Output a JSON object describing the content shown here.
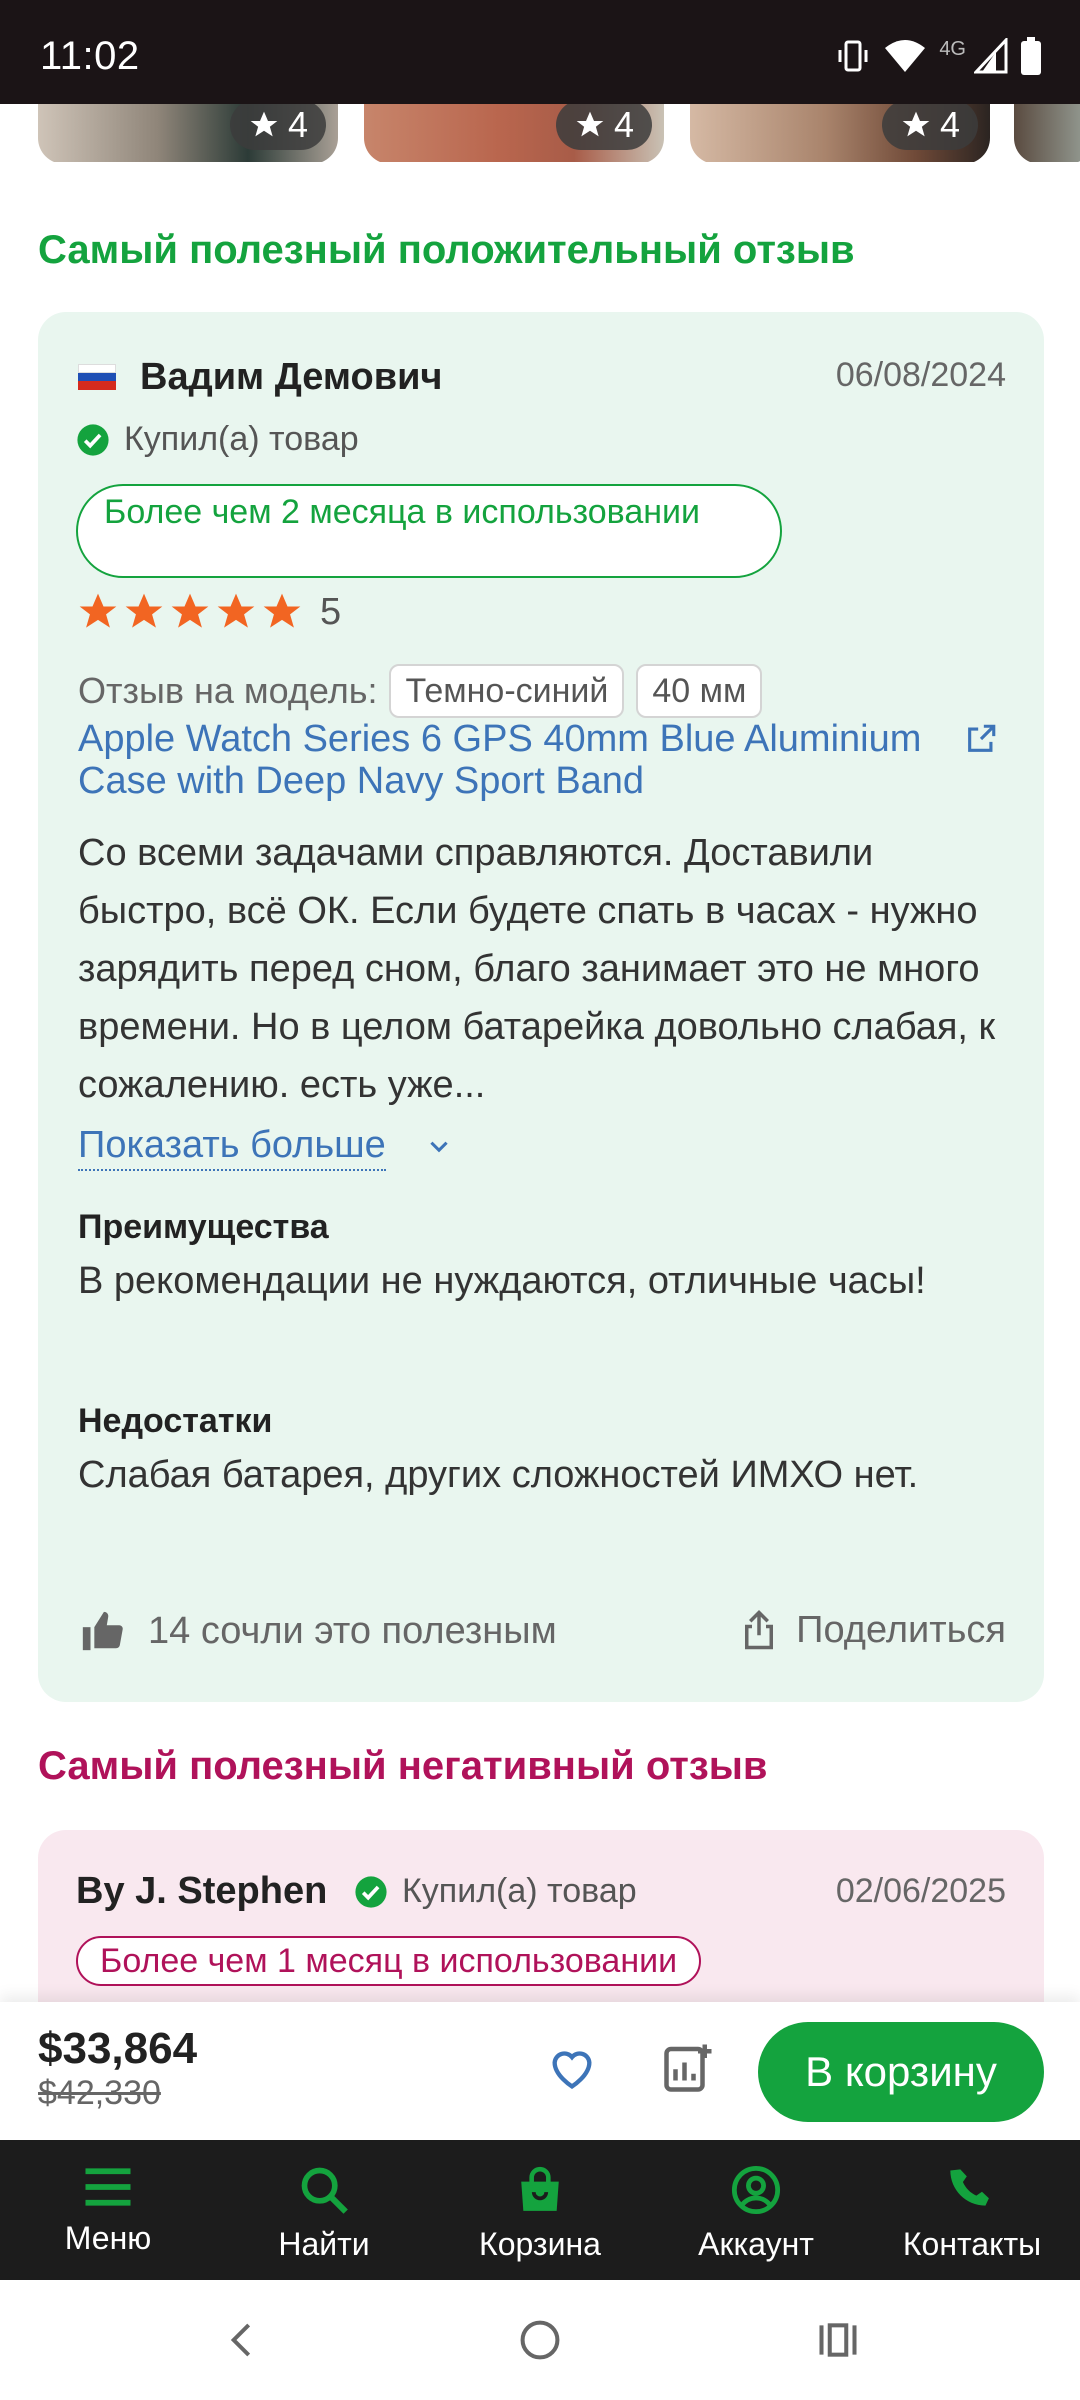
{
  "status_bar": {
    "time": "11:02",
    "network": "4G"
  },
  "photos": [
    {
      "rating": "4"
    },
    {
      "rating": "4"
    },
    {
      "rating": "4"
    }
  ],
  "positive": {
    "section_title": "Самый полезный положительный отзыв",
    "author": "Вадим Демович",
    "date": "06/08/2024",
    "verified": "Купил(а) товар",
    "usage": "Более чем 2 месяца в использовании",
    "rating": "5",
    "model_label": "Отзыв на модель:",
    "chips": [
      "Темно-синий",
      "40 мм"
    ],
    "product_link": "Apple Watch Series 6 GPS 40mm Blue Aluminium Case with Deep Navy Sport Band",
    "text": "Со всеми задачами справляются. Доставили быстро, всё ОК. Если будете спать в часах - нужно зарядить перед сном, благо занимает это не много времени. Но в целом батарейка довольно слабая, к сожалению. есть уже...",
    "show_more": "Показать больше",
    "pros_title": "Преимущества",
    "pros": "В рекомендации не нуждаются, отличные часы!",
    "cons_title": "Недостатки",
    "cons": "Слабая батарея, других сложностей ИМХО нет.",
    "helpful": "14 сочли это полезным",
    "share": "Поделиться"
  },
  "negative": {
    "section_title": "Самый полезный негативный отзыв",
    "author": "By J. Stephen",
    "verified": "Купил(а) товар",
    "date": "02/06/2025",
    "usage": "Более чем 1 месяц в использовании"
  },
  "buy_bar": {
    "price": "$33,864",
    "old_price": "$42,330",
    "cart_label": "В корзину"
  },
  "bottom_nav": {
    "items": [
      {
        "label": "Меню",
        "icon": "menu-icon"
      },
      {
        "label": "Найти",
        "icon": "search-icon"
      },
      {
        "label": "Корзина",
        "icon": "bag-icon"
      },
      {
        "label": "Аккаунт",
        "icon": "account-icon"
      },
      {
        "label": "Контакты",
        "icon": "phone-icon"
      }
    ]
  },
  "colors": {
    "green": "#14a33e",
    "magenta": "#b0125a",
    "link": "#3d74b8",
    "star": "#f26522"
  }
}
